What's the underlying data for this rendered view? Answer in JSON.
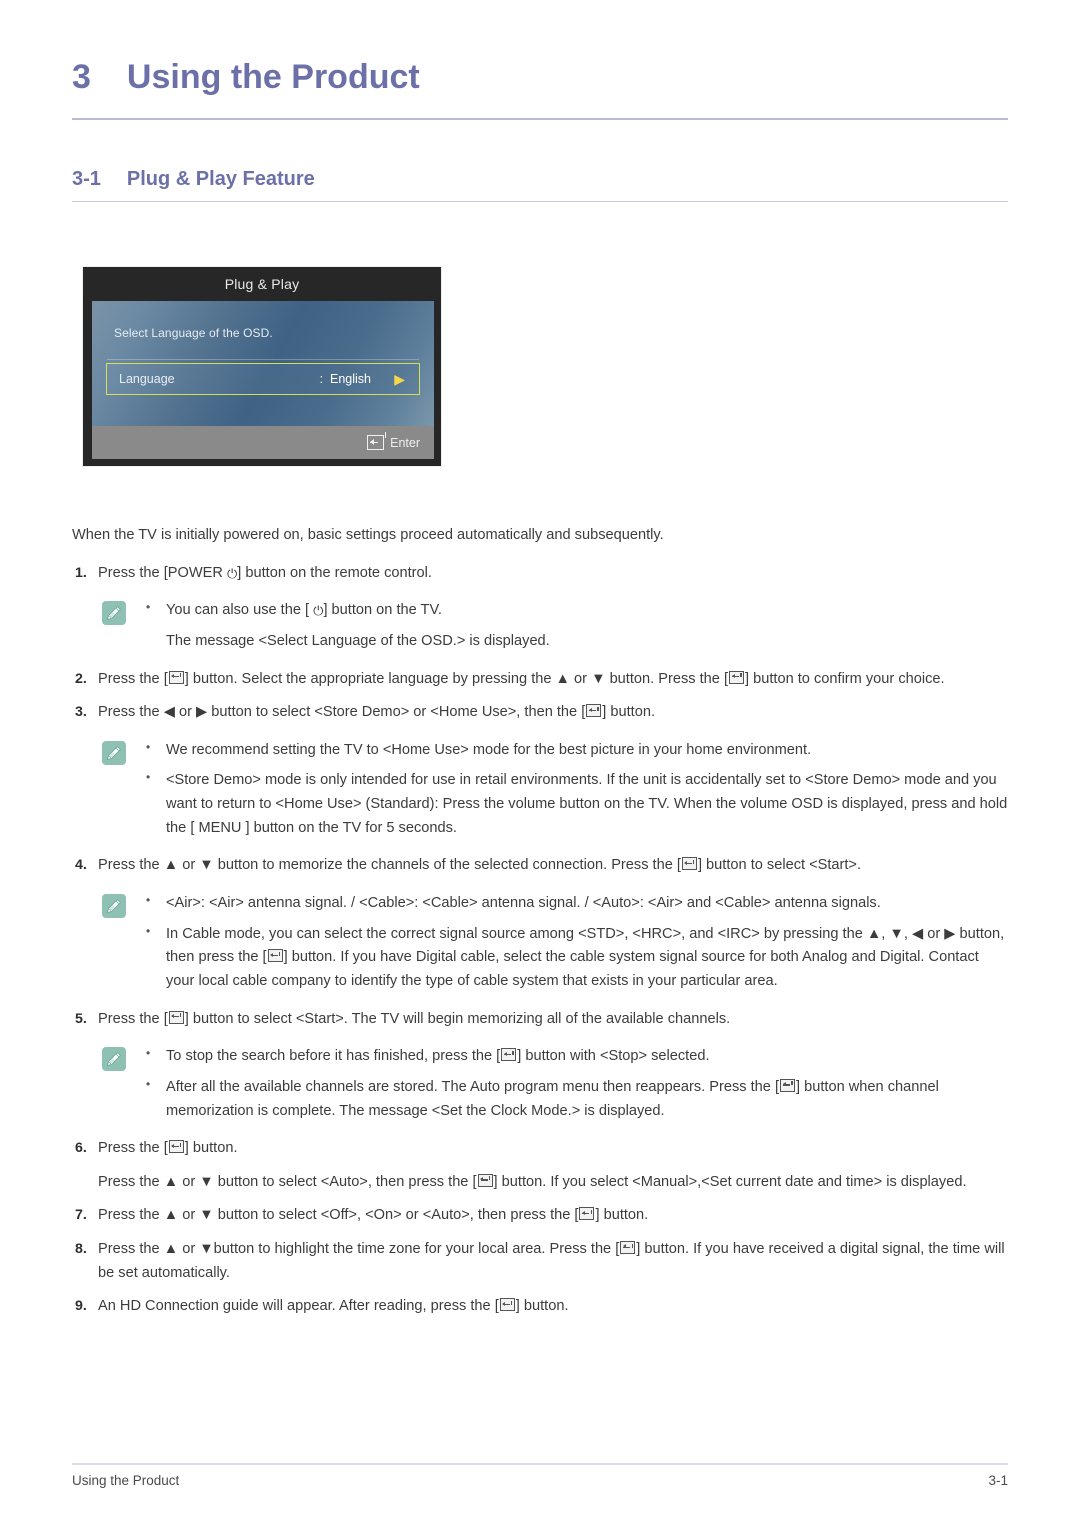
{
  "chapter": {
    "number": "3",
    "title": "Using the Product"
  },
  "section": {
    "number": "3-1",
    "title": "Plug & Play Feature"
  },
  "osd": {
    "title": "Plug & Play",
    "message": "Select Language of the OSD.",
    "row_label": "Language",
    "row_value": ":  English",
    "arrow": "▶",
    "enter_label": "Enter"
  },
  "body": {
    "intro": "When the TV is initially powered on, basic settings proceed automatically and subsequently.",
    "steps": [
      {
        "num": "1.",
        "parts": [
          {
            "t": "text",
            "v": "Press the [POWER "
          },
          {
            "t": "power"
          },
          {
            "t": "text",
            "v": "] button on the remote control."
          }
        ]
      },
      {
        "num": "2.",
        "parts": [
          {
            "t": "text",
            "v": "Press the ["
          },
          {
            "t": "enter"
          },
          {
            "t": "text",
            "v": "] button. Select the appropriate language by pressing the ▲ or ▼ button. Press the ["
          },
          {
            "t": "enter"
          },
          {
            "t": "text",
            "v": "] button to confirm your choice."
          }
        ]
      },
      {
        "num": "3.",
        "parts": [
          {
            "t": "text",
            "v": "Press the ◀ or ▶ button to select <Store Demo> or <Home Use>, then the ["
          },
          {
            "t": "enter"
          },
          {
            "t": "text",
            "v": "] button."
          }
        ]
      },
      {
        "num": "4.",
        "parts": [
          {
            "t": "text",
            "v": "Press the ▲ or ▼ button to memorize the channels of the selected connection. Press the ["
          },
          {
            "t": "enter"
          },
          {
            "t": "text",
            "v": "] button to select <Start>."
          }
        ]
      },
      {
        "num": "5.",
        "parts": [
          {
            "t": "text",
            "v": "Press the ["
          },
          {
            "t": "enter"
          },
          {
            "t": "text",
            "v": "] button to select <Start>. The TV will begin memorizing all of the available channels."
          }
        ]
      },
      {
        "num": "6.",
        "parts": [
          {
            "t": "text",
            "v": "Press the ["
          },
          {
            "t": "enter"
          },
          {
            "t": "text",
            "v": "] button."
          }
        ]
      },
      {
        "num": "7.",
        "parts": [
          {
            "t": "text",
            "v": "Press the ▲ or ▼ button to select <Off>, <On> or <Auto>, then press the ["
          },
          {
            "t": "enter"
          },
          {
            "t": "text",
            "v": "] button."
          }
        ]
      },
      {
        "num": "8.",
        "parts": [
          {
            "t": "text",
            "v": "Press the ▲ or ▼button to highlight the time zone for your local area. Press the ["
          },
          {
            "t": "enter"
          },
          {
            "t": "text",
            "v": "] button. If you have received a digital signal, the time will be set automatically."
          }
        ]
      },
      {
        "num": "9.",
        "parts": [
          {
            "t": "text",
            "v": "An HD Connection guide will appear. After reading, press the ["
          },
          {
            "t": "enter"
          },
          {
            "t": "text",
            "v": "] button."
          }
        ]
      }
    ],
    "step6_continuation": [
      {
        "t": "text",
        "v": "Press the ▲ or ▼ button to select <Auto>, then press the ["
      },
      {
        "t": "enter"
      },
      {
        "t": "text",
        "v": "] button. If you select <Manual>,<Set current date and time> is displayed."
      }
    ],
    "notes": [
      {
        "after_step": "1",
        "items": [
          [
            {
              "t": "text",
              "v": "You can also use the [ "
            },
            {
              "t": "power"
            },
            {
              "t": "text",
              "v": "] button on the TV."
            }
          ],
          [
            {
              "t": "text",
              "v": "The message <Select Language of the OSD.> is displayed."
            }
          ]
        ],
        "bulleted": [
          true,
          false
        ]
      },
      {
        "after_step": "3",
        "items": [
          [
            {
              "t": "text",
              "v": "We recommend setting the TV to <Home Use> mode for the best picture in your home environment."
            }
          ],
          [
            {
              "t": "text",
              "v": "<Store Demo> mode is only intended for use in retail environments. If the unit is accidentally set to <Store Demo> mode and you want to return to <Home Use> (Standard): Press the volume button on the TV. When the volume OSD is displayed, press and hold the [ MENU ] button on the TV for 5 seconds."
            }
          ]
        ],
        "bulleted": [
          true,
          true
        ]
      },
      {
        "after_step": "4",
        "items": [
          [
            {
              "t": "text",
              "v": "<Air>: <Air> antenna signal. / <Cable>: <Cable> antenna signal. / <Auto>: <Air> and <Cable> antenna signals."
            }
          ],
          [
            {
              "t": "text",
              "v": "In Cable mode, you can select the correct signal source among <STD>, <HRC>, and <IRC> by pressing the ▲, ▼, ◀ or ▶ button, then press the ["
            },
            {
              "t": "enter"
            },
            {
              "t": "text",
              "v": "] button. If you have Digital cable, select the cable system signal source for both Analog and Digital. Contact your local cable company to identify the type of cable system that exists in your particular area."
            }
          ]
        ],
        "bulleted": [
          true,
          true
        ]
      },
      {
        "after_step": "5",
        "items": [
          [
            {
              "t": "text",
              "v": "To stop the search before it has finished, press the ["
            },
            {
              "t": "enter"
            },
            {
              "t": "text",
              "v": "] button with <Stop> selected."
            }
          ],
          [
            {
              "t": "text",
              "v": "After all the available channels are stored. The Auto program menu then reappears. Press the ["
            },
            {
              "t": "enter"
            },
            {
              "t": "text",
              "v": "] button when channel memorization is complete. The message <Set the Clock Mode.> is displayed."
            }
          ]
        ],
        "bulleted": [
          true,
          true
        ]
      }
    ]
  },
  "footer": {
    "left": "Using the Product",
    "right": "3-1"
  },
  "colors": {
    "heading": "#6c70a8",
    "note_icon_bg": "#8ec0b3",
    "osd_highlight_border": "#d8dd52",
    "osd_arrow": "#f3d64a"
  }
}
